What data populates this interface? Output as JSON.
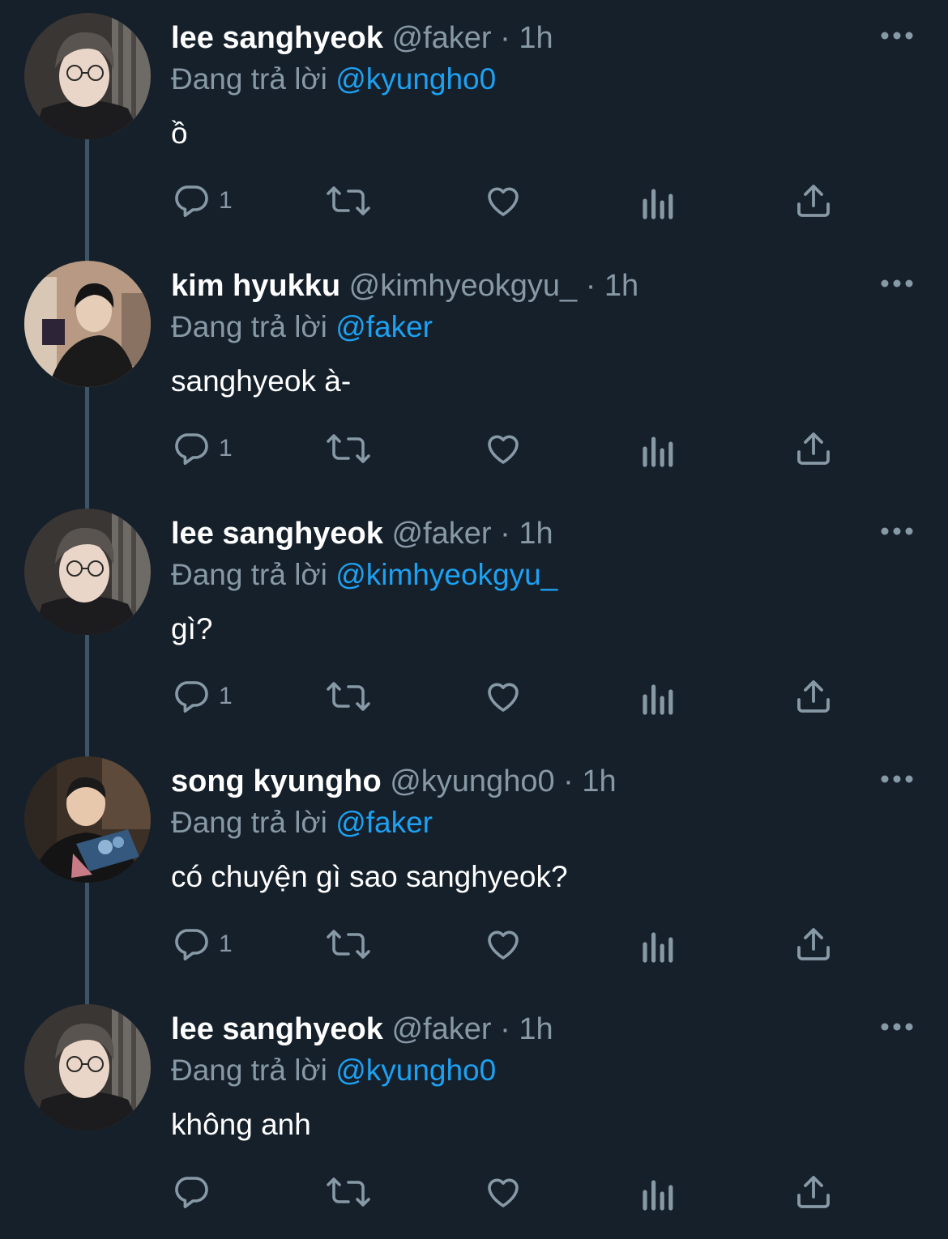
{
  "thread": {
    "tweets": [
      {
        "display_name": "lee sanghyeok",
        "handle": "@faker",
        "time": "1h",
        "reply_prefix": "Đang trả lời",
        "reply_to": "@kyungho0",
        "text": "ồ",
        "reply_count": "1",
        "avatar": "avatar-faker"
      },
      {
        "display_name": "kim hyukku",
        "handle": "@kimhyeokgyu_",
        "time": "1h",
        "reply_prefix": "Đang trả lời",
        "reply_to": "@faker",
        "text": "sanghyeok à-",
        "reply_count": "1",
        "avatar": "avatar-kimhyeokgyu"
      },
      {
        "display_name": "lee sanghyeok",
        "handle": "@faker",
        "time": "1h",
        "reply_prefix": "Đang trả lời",
        "reply_to": "@kimhyeokgyu_",
        "text": "gì?",
        "reply_count": "1",
        "avatar": "avatar-faker"
      },
      {
        "display_name": "song kyungho",
        "handle": "@kyungho0",
        "time": "1h",
        "reply_prefix": "Đang trả lời",
        "reply_to": "@faker",
        "text": "có chuyện gì sao sanghyeok?",
        "reply_count": "1",
        "avatar": "avatar-kyungho"
      },
      {
        "display_name": "lee sanghyeok",
        "handle": "@faker",
        "time": "1h",
        "reply_prefix": "Đang trả lời",
        "reply_to": "@kyungho0",
        "text": "không anh",
        "reply_count": "",
        "avatar": "avatar-faker"
      }
    ],
    "separator": "·",
    "icons": [
      "reply-icon",
      "retweet-icon",
      "like-icon",
      "analytics-icon",
      "share-icon",
      "more-icon"
    ],
    "colors": {
      "background": "#15202b",
      "muted": "#8899a6",
      "mention": "#1da1f2",
      "thread_line": "#3d5466"
    }
  }
}
